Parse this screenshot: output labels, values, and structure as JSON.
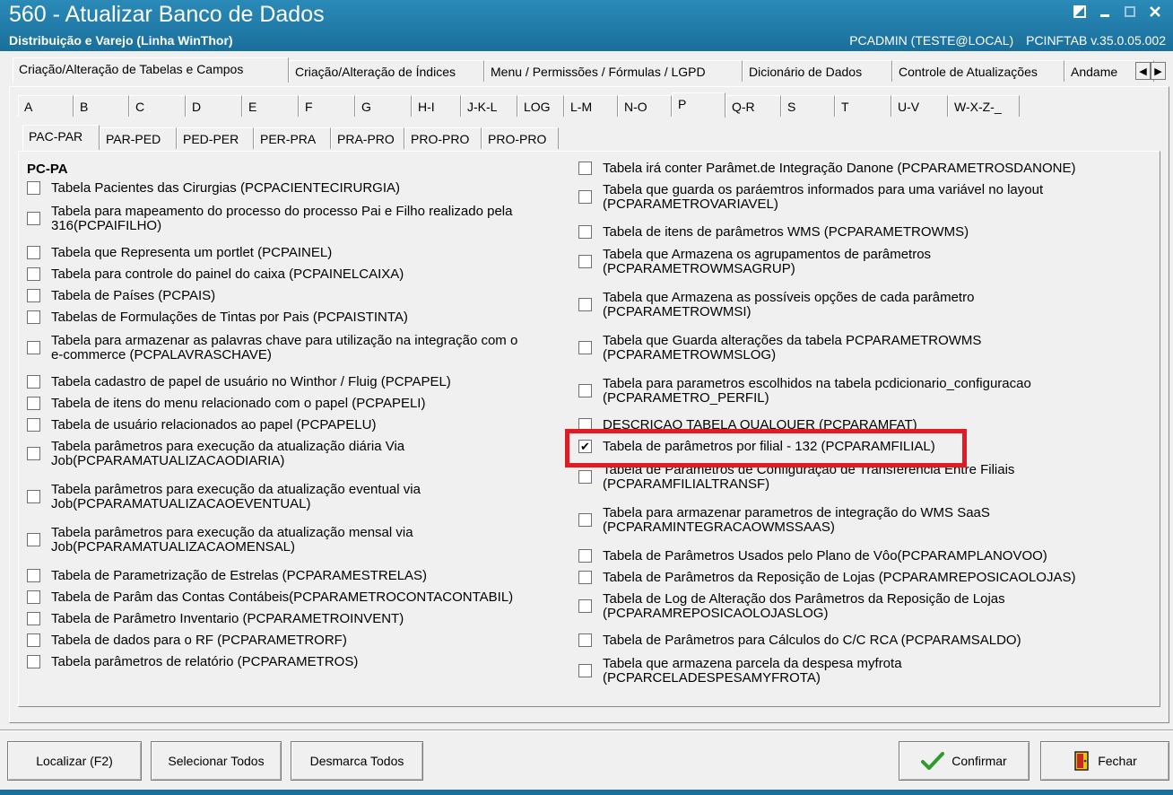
{
  "window": {
    "title": "560 - Atualizar Banco de Dados",
    "subtitle": "Distribuição e Varejo (Linha WinThor)",
    "user": "PCADMIN (TESTE@LOCAL)",
    "version": "PCINFTAB  v.35.0.05.002"
  },
  "tabs_main": [
    {
      "label": "Criação/Alteração de Tabelas e Campos",
      "active": true
    },
    {
      "label": "Criação/Alteração de Índices"
    },
    {
      "label": "Menu / Permissões / Fórmulas / LGPD"
    },
    {
      "label": "Dicionário de Dados"
    },
    {
      "label": "Controle de Atualizações"
    },
    {
      "label": "Andame"
    }
  ],
  "tabs_letter": [
    {
      "label": "A"
    },
    {
      "label": "B"
    },
    {
      "label": "C"
    },
    {
      "label": "D"
    },
    {
      "label": "E"
    },
    {
      "label": "F"
    },
    {
      "label": "G"
    },
    {
      "label": "H-I"
    },
    {
      "label": "J-K-L"
    },
    {
      "label": "LOG"
    },
    {
      "label": "L-M"
    },
    {
      "label": "N-O"
    },
    {
      "label": "P",
      "active": true
    },
    {
      "label": "Q-R"
    },
    {
      "label": "S"
    },
    {
      "label": "T"
    },
    {
      "label": "U-V"
    },
    {
      "label": "W-X-Z-_"
    }
  ],
  "tabs_range": [
    {
      "label": "PAC-PAR",
      "active": true
    },
    {
      "label": "PAR-PED"
    },
    {
      "label": "PED-PER"
    },
    {
      "label": "PER-PRA"
    },
    {
      "label": "PRA-PRO"
    },
    {
      "label": "PRO-PRO"
    },
    {
      "label": "PRO-PRO"
    }
  ],
  "group_title": "PC-PA",
  "left_items": [
    {
      "lines": [
        "Tabela Pacientes das Cirurgias (PCPACIENTECIRURGIA)"
      ],
      "checked": false
    },
    {
      "lines": [
        "Tabela para mapeamento do processo do processo Pai e Filho realizado pela",
        "316(PCPAIFILHO)"
      ],
      "checked": false
    },
    {
      "lines": [
        "Tabela que Representa um portlet (PCPAINEL)"
      ],
      "checked": false
    },
    {
      "lines": [
        "Tabela para controle do painel do caixa (PCPAINELCAIXA)"
      ],
      "checked": false
    },
    {
      "lines": [
        "Tabela de Países (PCPAIS)"
      ],
      "checked": false
    },
    {
      "lines": [
        "Tabelas de Formulações de Tintas por Pais (PCPAISTINTA)"
      ],
      "checked": false
    },
    {
      "lines": [
        "Tabela para armazenar as palavras chave para utilização na integração com o",
        "e-commerce (PCPALAVRASCHAVE)"
      ],
      "checked": false
    },
    {
      "lines": [
        "Tabela cadastro de papel de usuário no Winthor / Fluig (PCPAPEL)"
      ],
      "checked": false
    },
    {
      "lines": [
        "Tabela de itens do menu relacionado com o papel (PCPAPELI)"
      ],
      "checked": false
    },
    {
      "lines": [
        "Tabela de usuário relacionados ao papel (PCPAPELU)"
      ],
      "checked": false
    },
    {
      "lines": [
        "Tabela parâmetros para execução da atualização diária Via",
        "Job(PCPARAMATUALIZACAODIARIA)"
      ],
      "checked": false
    },
    {
      "lines": [
        "Tabela parâmetros para execução da atualização eventual via",
        "Job(PCPARAMATUALIZACAOEVENTUAL)"
      ],
      "checked": false
    },
    {
      "lines": [
        "Tabela parâmetros para execução da atualização mensal via",
        "Job(PCPARAMATUALIZACAOMENSAL)"
      ],
      "checked": false
    },
    {
      "lines": [
        "Tabela de Parametrização de Estrelas (PCPARAMESTRELAS)"
      ],
      "checked": false
    },
    {
      "lines": [
        "Tabela de Parâm das Contas Contábeis(PCPARAMETROCONTACONTABIL)"
      ],
      "checked": false
    },
    {
      "lines": [
        "Tabela de Parâmetro Inventario (PCPARAMETROINVENT)"
      ],
      "checked": false
    },
    {
      "lines": [
        "Tabela de dados para o RF (PCPARAMETRORF)"
      ],
      "checked": false
    },
    {
      "lines": [
        "Tabela parâmetros de relatório (PCPARAMETROS)"
      ],
      "checked": false
    }
  ],
  "right_items": [
    {
      "lines": [
        "Tabela irá conter Parâmet.de Integração Danone (PCPARAMETROSDANONE)"
      ],
      "checked": false
    },
    {
      "lines": [
        "Tabela que guarda os paráemtros informados para uma variável no layout",
        "(PCPARAMETROVARIAVEL)"
      ],
      "checked": false
    },
    {
      "lines": [
        "Tabela de itens de parâmetros WMS (PCPARAMETROWMS)"
      ],
      "checked": false
    },
    {
      "lines": [
        "Tabela que Armazena os agrupamentos de parâmetros",
        "(PCPARAMETROWMSAGRUP)"
      ],
      "checked": false
    },
    {
      "lines": [
        "Tabela que Armazena as possíveis opções de cada parâmetro",
        "(PCPARAMETROWMSI)"
      ],
      "checked": false
    },
    {
      "lines": [
        "Tabela que Guarda alterações da tabela PCPARAMETROWMS",
        "(PCPARAMETROWMSLOG)"
      ],
      "checked": false
    },
    {
      "lines": [
        "Tabela para parametros escolhidos na tabela pcdicionario_configuracao",
        "(PCPARAMETRO_PERFIL)"
      ],
      "checked": false
    },
    {
      "lines": [
        "DESCRICAO TABELA QUALQUER (PCPARAMFAT)"
      ],
      "checked": false
    },
    {
      "lines": [
        "Tabela de parâmetros por filial - 132 (PCPARAMFILIAL)"
      ],
      "checked": true
    },
    {
      "lines": [
        "Tabela de Parâmetros de Configuração de Transferência Entre Filiais",
        "(PCPARAMFILIALTRANSF)"
      ],
      "checked": false
    },
    {
      "lines": [
        "Tabela para armazenar parametros de integração do WMS SaaS",
        "(PCPARAMINTEGRACAOWMSSAAS)"
      ],
      "checked": false
    },
    {
      "lines": [
        "Tabela de Parâmetros Usados pelo Plano de Vôo(PCPARAMPLANOVOO)"
      ],
      "checked": false
    },
    {
      "lines": [
        "Tabela de Parâmetros da Reposição de Lojas (PCPARAMREPOSICAOLOJAS)"
      ],
      "checked": false
    },
    {
      "lines": [
        "Tabela de Log de Alteração dos Parâmetros da Reposição de Lojas",
        "(PCPARAMREPOSICAOLOJASLOG)"
      ],
      "checked": false
    },
    {
      "lines": [
        "Tabela de Parâmetros para Cálculos do C/C RCA (PCPARAMSALDO)"
      ],
      "checked": false
    },
    {
      "lines": [
        "Tabela que armazena parcela da despesa myfrota",
        "(PCPARCELADESPESAMYFROTA)"
      ],
      "checked": false
    }
  ],
  "buttons": {
    "localizar": "Localizar (F2)",
    "selecionar": "Selecionar Todos",
    "desmarca": "Desmarca Todos",
    "confirmar": "Confirmar",
    "fechar": "Fechar"
  },
  "colors": {
    "titlebar": "#1a6f9b",
    "highlight": "#e21a24",
    "confirm_icon": "#2e9a2e"
  }
}
